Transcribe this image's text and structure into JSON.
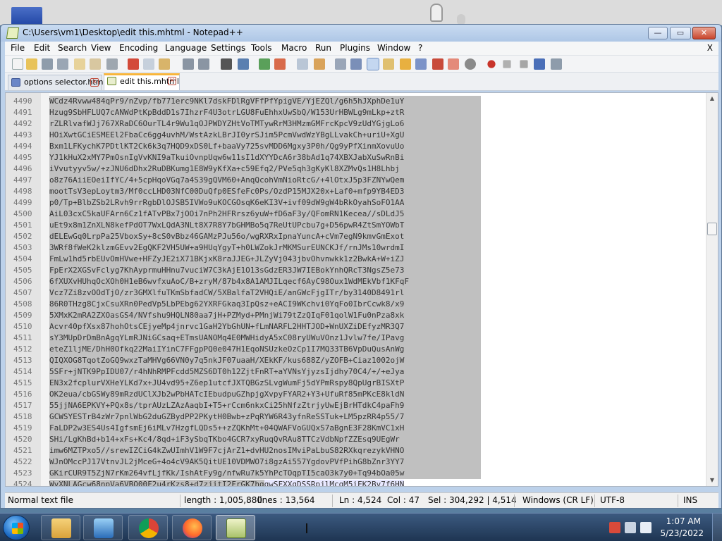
{
  "window": {
    "title": "C:\\Users\\vm1\\Desktop\\edit this.mhtml - Notepad++",
    "min_label": "—",
    "max_label": "▭",
    "close_label": "✕"
  },
  "menu": {
    "items": [
      "File",
      "Edit",
      "Search",
      "View",
      "Encoding",
      "Language",
      "Settings",
      "Tools",
      "Macro",
      "Run",
      "Plugins",
      "Window",
      "?"
    ],
    "close_doc": "X"
  },
  "toolbar": {
    "icons": [
      "new-file-icon",
      "open-file-icon",
      "save-icon",
      "save-all-icon",
      "close-icon",
      "close-all-icon",
      "print-icon",
      "cut-icon",
      "copy-icon",
      "paste-icon",
      "undo-icon",
      "redo-icon",
      "find-icon",
      "replace-icon",
      "zoom-in-icon",
      "zoom-out-icon",
      "sync-vertical-icon",
      "sync-horizontal-icon",
      "word-wrap-icon",
      "show-all-chars-icon",
      "indent-guide-icon",
      "user-define-icon",
      "doc-map-icon",
      "doc-list-icon",
      "function-list-icon",
      "folder-workspace-icon",
      "monitoring-icon",
      "record-macro-icon",
      "stop-macro-icon",
      "play-macro-icon",
      "run-macro-multiple-icon",
      "save-macro-icon"
    ]
  },
  "tabs": [
    {
      "label": "options selector.html",
      "active": false
    },
    {
      "label": "edit this.mhtml",
      "active": true
    }
  ],
  "editor": {
    "lines": [
      {
        "num": "4490",
        "text": "WCdz4Rvww484qPr9/nZvp/fb771erc9NKl7dskFDlRgVFfPfYpigVE/YjEZQl/g6h5hJXphDe1uY"
      },
      {
        "num": "4491",
        "text": "Hzug9SbHFLUQ7cANWdPtKpBddD1s7IhzrF4U3otrLGU8FuEhhxUwSbQ/W153UrHBWLg9mLkp+ztR"
      },
      {
        "num": "4492",
        "text": "rZLRlvafWJj767XRaDC6OurTL4r9Wu1qOJPWDYZHtVoTMTywRrM3HMzmGMFrcKpcV9zUdYGjgLo6"
      },
      {
        "num": "4493",
        "text": "HOiXwtGCiESMEEl2FbaCc6gg4uvhM/WstAzkLBrJI0yrSJim5PcmVwdWzYBgLLvakCh+uriU+XgU"
      },
      {
        "num": "4494",
        "text": "Bxm1LFKychK7PDtlKT2Ck6k3q7HQD9xDS0Lf+baaVy725svMDD6Mgxy3P0h/Qg9yPfXinmXovuUo"
      },
      {
        "num": "4495",
        "text": "YJ1kHuX2xMY7PmOsnIgVvKNI9aTkuiOvnpUqw6w11sI1dXYYDcA6r38bAd1q74XBXJabXuSwRnBi"
      },
      {
        "num": "4496",
        "text": "iVvutyyv5w/+zJNU6dDhx2RuDBKumg1E8W9yKfXa+c59Efq2/PVe5qh3gKyKl8XZMvQs1H8Lhbj"
      },
      {
        "num": "4497",
        "text": "o8z76AiiEOeiIfYC/4+5cpHqoVGq7a4S39gQVM60+AnqQcohVmNioRtcG/+4lOtxJ5p3FZNYwQem"
      },
      {
        "num": "4498",
        "text": "mootTsV3epLoytm3/Mf0ccLHD03NfC00DuQfp0ESfeFc0Ps/OzdP15MJX20x+Laf0+mfp9YB4ED3"
      },
      {
        "num": "4499",
        "text": "p0/Tp+BlbZSb2LRvh9rrRgbDlOJSB5IVWo9uKOCGOsqK6eKI3V+ivf09dW9gW4bRkOyahSoFO1AA"
      },
      {
        "num": "4500",
        "text": "AiL03cxC5kaUFArn6Cz1fATvPBx7jOOi7nPh2HFRrsz6yuW+fD6aF3y/QFomRN1Kecea//sDLdJ5"
      },
      {
        "num": "4501",
        "text": "uEt9x8m1ZnXLN8kefPdOT7WxLQdA3NLt8X7R8Y7bGHMBo5q7ReUtUPcbu7g+D56pwR4ZtSmYOWbT"
      },
      {
        "num": "4502",
        "text": "dELEwGq0LrpPa25VboxSy+8cS0vBbz46GAMzPJu56o/wgRXRxIpnaYuncA+cVm7egN9kmvGmExot"
      },
      {
        "num": "4503",
        "text": "3WRf8fWeK2klzmGEvv2EgQKF2VH5UW+a9HUqYgyT+h0LWZokJrMKMSurEUNCKJf/rnJMs10wrdmI"
      },
      {
        "num": "4504",
        "text": "FmLw1hd5rbEUvOmHVwe+HFZyJE2iX71BKjxK8raJJEG+JLZyVj043jbvOhvnwkk1z2BwkA+W+iZJ"
      },
      {
        "num": "4505",
        "text": "FpErX2XGSvFclyg7KhAyprmuHHnu7vuciW7C3kAjE1O13sGdzER3JW7IEBokYnhQRcT3NgsZ5e73"
      },
      {
        "num": "4506",
        "text": "6fXUXvHUhqOcXOh0H1eB6wvfxuAoC/B+zryM/87b4x8A1AMJILqecf6AyC98Oux1WdMEkVbf1KFqF"
      },
      {
        "num": "4507",
        "text": "Vcz7Zi8zvOOdTjO/zr3GMXlfuTKmSbfadCW/5XBalfaT2VHQiE/anGWcFjgITr/by3140D8491rl"
      },
      {
        "num": "4508",
        "text": "86R0THzg8CjxCsuXRn0PedVp5LbPEbg62YXRFGkaq3IpQsz+eACI9WKchvi0YqFo0IbrCcwk8/x9"
      },
      {
        "num": "4509",
        "text": "5XMxK2mRA2ZXOasGS4/NVfshu9HQLN80aa7jH+PZMyd+PMnjWi79tZzQIqF01qolW1Fu0nPza8xk"
      },
      {
        "num": "4510",
        "text": "Acvr40pfXsx87hohOtsCEjyeMp4jnrvc1GaH2YbGhUN+fLmNARFL2HHTJOD+WnUXZiDEfyzMR3Q7"
      },
      {
        "num": "4511",
        "text": "sY3MUpDrDmBnAgqYLmRJNiGCsaq+ETmsUANOMq4E0MWHidyA5xC08ryUWuVOnz1Jvlw7fe/IPavg"
      },
      {
        "num": "4512",
        "text": "eteZ1ljME/DhH0Ofkq22MaiIYinC7FFgpPQ0e047H1EqoNSUzkeOzCp1I7MQ33TB6VpDuQusAnWg"
      },
      {
        "num": "4513",
        "text": "QIQXOG8TqotZoGQ9wxzTaMHVg66VN0y7q5nkJF07uaaH/XEkKF/kus688Z/yZOFB+Ciaz1002ojW"
      },
      {
        "num": "4514",
        "text": "5SFr+jNTK9PpIDU07/r4hNhRMPFcdd5MZS6DT0h12ZjtFnRT+aYVNsYjyzsIjdhy70C4/+/+eJya"
      },
      {
        "num": "4515",
        "text": "EN3x2fcplurVXHeYLKd7x+JU4vd95+Z6ep1utcfJXTQBGzSLvgWumFj5dYPmRspy8QpUgrBISXtP"
      },
      {
        "num": "4516",
        "text": "OK2eua/cbGSWy89mRzdUClXJb2wPbHATcIEbudpuGZhpjgXvpyFYAR2+Y3+UfuRf85mPKcE8kldN"
      },
      {
        "num": "4517",
        "text": "55jjNA6EPKVY+PQx8s/tprAUzLZAzAaqbI+T5+rCcm6nkxCi25hNfzZtrjyUwEjBrHTdkC4paFh9"
      },
      {
        "num": "4518",
        "text": "GCWSYESTrB4zWr7pnlWbG2duGZBydPP2PKytH0Bwb+zPqRYW6R43yfnReSSTuk+LM5pzRR4p55/7"
      },
      {
        "num": "4519",
        "text": "FaLDP2w3ES4Us4IgfsmEj6iMLv7HzgfLQDs5++zZQKhMt+04QWAFVoGUQxS7aBgnE3F28KmVC1xH"
      },
      {
        "num": "4520",
        "text": "SHi/LgKhBd+b14+xFs+Kc4/8qd+iF3ySbqTKbo4GCR7xyRuqQvRAu8TTCzVdbNpfZZEsq9UEgWr"
      },
      {
        "num": "4521",
        "text": "imw6MZTPxo5//srewIZCiG4kZwUImhV1W9F7cjArZ1+dvHU2nosIMviPaLbuS82RXkqrezykVHNO"
      },
      {
        "num": "4522",
        "text": "WJnOMccPJ17VtnvJL2jMceG+4o4cV9AK5QitUE10VDMWO7i8gzAi557YgdovPVfPihG8bZnr3YY7"
      },
      {
        "num": "4523",
        "text": "GKirCUR9T5ZjN7rKm264vfLjfKk/IshAtFy9g/nfwRu7k5YhPcTOqpTI5caO3k7y0+Tq94bOa05w"
      }
    ],
    "current_line": {
      "num": "4524",
      "selected_text": "WvXNLAGcw68npVa6VBO00F2u4rKzs8+d7zjitI2FrGK7hg",
      "rest_text": "qwSFXXqDSSRpjlMcgM5iEK2Bv7f6HN"
    }
  },
  "status": {
    "file_type": "Normal text file",
    "length": "length : 1,005,880",
    "lines": "lines : 13,564",
    "position": "Ln : 4,524",
    "column": "Col : 47",
    "selection": "Sel : 304,292 | 4,514",
    "eol": "Windows (CR LF)",
    "encoding": "UTF-8",
    "mode": "INS"
  },
  "taskbar": {
    "apps": [
      "file-explorer-icon",
      "media-player-icon",
      "chrome-icon",
      "firefox-icon",
      "notepad-plus-plus-icon"
    ],
    "time": "1:07 AM",
    "date": "5/23/2022"
  },
  "colors": {
    "selection": "#c0c0c0",
    "active_tab_accent": "#f8b53a",
    "taskbar": "#2a4566"
  }
}
